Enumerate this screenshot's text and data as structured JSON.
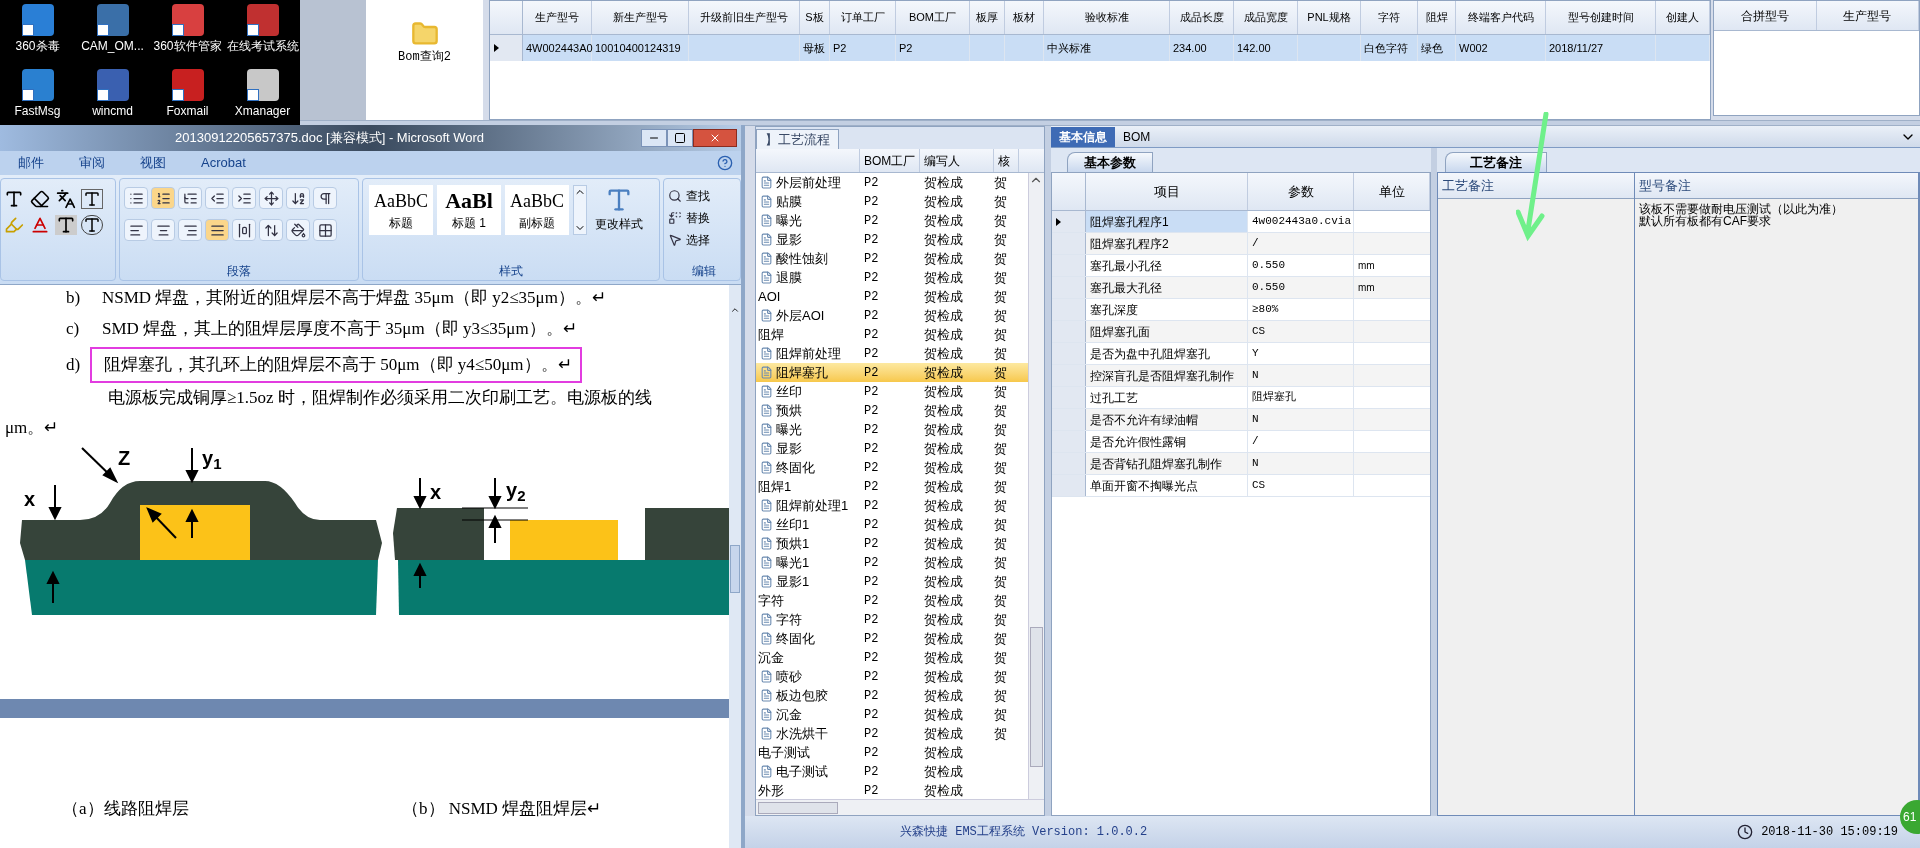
{
  "desktop": {
    "icons": [
      {
        "label": "360杀毒"
      },
      {
        "label": "CAM_OM..."
      },
      {
        "label": "360软件管家"
      },
      {
        "label": "在线考试系统"
      },
      {
        "label": "FastMsg"
      },
      {
        "label": "wincmd"
      },
      {
        "label": "Foxmail"
      },
      {
        "label": "Xmanager"
      }
    ]
  },
  "ems": {
    "nav": {
      "items": [
        {
          "label": "Bom查询2"
        }
      ]
    },
    "model_grid": {
      "columns": [
        "生产型号",
        "新生产型号",
        "升级前旧生产型号",
        "S板",
        "订单工厂",
        "BOM工厂",
        "板厚",
        "板材",
        "验收标准",
        "成品长度",
        "成品宽度",
        "PNL规格",
        "字符",
        "阻焊",
        "终端客户代码",
        "型号创建时间",
        "创建人"
      ],
      "rows": [
        {
          "selected": true,
          "cells": [
            "4W002443A0",
            "10010400124319",
            null,
            "母板",
            "P2",
            "P2",
            null,
            null,
            "中兴标准",
            "234.00",
            "142.00",
            null,
            "白色字符",
            "绿色",
            "W002",
            "2018/11/27",
            null
          ]
        }
      ]
    },
    "merge_grid": {
      "columns": [
        "合拼型号",
        "生产型号"
      ]
    },
    "process_panel": {
      "tab": "】工艺流程",
      "columns": [
        "BOM工厂",
        "编写人",
        "核"
      ],
      "rows": [
        {
          "kind": "step",
          "name": "外层前处理",
          "bom": "P2",
          "writer": "贺检成",
          "reviewer": "贺",
          "selected": false
        },
        {
          "kind": "step",
          "name": "贴膜",
          "bom": "P2",
          "writer": "贺检成",
          "reviewer": "贺",
          "selected": false
        },
        {
          "kind": "step",
          "name": "曝光",
          "bom": "P2",
          "writer": "贺检成",
          "reviewer": "贺",
          "selected": false
        },
        {
          "kind": "step",
          "name": "显影",
          "bom": "P2",
          "writer": "贺检成",
          "reviewer": "贺",
          "selected": false
        },
        {
          "kind": "step",
          "name": "酸性蚀刻",
          "bom": "P2",
          "writer": "贺检成",
          "reviewer": "贺",
          "selected": false
        },
        {
          "kind": "step",
          "name": "退膜",
          "bom": "P2",
          "writer": "贺检成",
          "reviewer": "贺",
          "selected": false
        },
        {
          "kind": "group",
          "name": "AOI",
          "bom": "P2",
          "writer": "贺检成",
          "reviewer": "贺",
          "selected": false,
          "children": [
            {
              "kind": "step",
              "name": "外层AOI",
              "bom": "P2",
              "writer": "贺检成",
              "reviewer": "贺",
              "selected": false
            }
          ]
        },
        {
          "kind": "group",
          "name": "阻焊",
          "bom": "P2",
          "writer": "贺检成",
          "reviewer": "贺",
          "selected": false,
          "children": [
            {
              "kind": "step",
              "name": "阻焊前处理",
              "bom": "P2",
              "writer": "贺检成",
              "reviewer": "贺",
              "selected": false
            },
            {
              "kind": "step",
              "name": "阻焊塞孔",
              "bom": "P2",
              "writer": "贺检成",
              "reviewer": "贺",
              "selected": true
            },
            {
              "kind": "step",
              "name": "丝印",
              "bom": "P2",
              "writer": "贺检成",
              "reviewer": "贺",
              "selected": false
            },
            {
              "kind": "step",
              "name": "预烘",
              "bom": "P2",
              "writer": "贺检成",
              "reviewer": "贺",
              "selected": false
            },
            {
              "kind": "step",
              "name": "曝光",
              "bom": "P2",
              "writer": "贺检成",
              "reviewer": "贺",
              "selected": false
            },
            {
              "kind": "step",
              "name": "显影",
              "bom": "P2",
              "writer": "贺检成",
              "reviewer": "贺",
              "selected": false
            },
            {
              "kind": "step",
              "name": "终固化",
              "bom": "P2",
              "writer": "贺检成",
              "reviewer": "贺",
              "selected": false
            }
          ]
        },
        {
          "kind": "group",
          "name": "阻焊1",
          "bom": "P2",
          "writer": "贺检成",
          "reviewer": "贺",
          "selected": false,
          "children": [
            {
              "kind": "step",
              "name": "阻焊前处理1",
              "bom": "P2",
              "writer": "贺检成",
              "reviewer": "贺",
              "selected": false
            },
            {
              "kind": "step",
              "name": "丝印1",
              "bom": "P2",
              "writer": "贺检成",
              "reviewer": "贺",
              "selected": false
            },
            {
              "kind": "step",
              "name": "预烘1",
              "bom": "P2",
              "writer": "贺检成",
              "reviewer": "贺",
              "selected": false
            },
            {
              "kind": "step",
              "name": "曝光1",
              "bom": "P2",
              "writer": "贺检成",
              "reviewer": "贺",
              "selected": false
            },
            {
              "kind": "step",
              "name": "显影1",
              "bom": "P2",
              "writer": "贺检成",
              "reviewer": "贺",
              "selected": false
            }
          ]
        },
        {
          "kind": "group",
          "name": "字符",
          "bom": "P2",
          "writer": "贺检成",
          "reviewer": "贺",
          "selected": false,
          "children": [
            {
              "kind": "step",
              "name": "字符",
              "bom": "P2",
              "writer": "贺检成",
              "reviewer": "贺",
              "selected": false
            },
            {
              "kind": "step",
              "name": "终固化",
              "bom": "P2",
              "writer": "贺检成",
              "reviewer": "贺",
              "selected": false
            }
          ]
        },
        {
          "kind": "group",
          "name": "沉金",
          "bom": "P2",
          "writer": "贺检成",
          "reviewer": "贺",
          "selected": false,
          "children": [
            {
              "kind": "step",
              "name": "喷砂",
              "bom": "P2",
              "writer": "贺检成",
              "reviewer": "贺",
              "selected": false
            },
            {
              "kind": "step",
              "name": "板边包胶",
              "bom": "P2",
              "writer": "贺检成",
              "reviewer": "贺",
              "selected": false
            },
            {
              "kind": "step",
              "name": "沉金",
              "bom": "P2",
              "writer": "贺检成",
              "reviewer": "贺",
              "selected": false
            },
            {
              "kind": "step",
              "name": "水洗烘干",
              "bom": "P2",
              "writer": "贺检成",
              "reviewer": "贺",
              "selected": false
            }
          ]
        },
        {
          "kind": "group",
          "name": "电子测试",
          "bom": "P2",
          "writer": "贺检成",
          "selected": false,
          "children": [
            {
              "kind": "step",
              "name": "电子测试",
              "bom": "P2",
              "writer": "贺检成",
              "selected": false
            }
          ]
        },
        {
          "kind": "group",
          "name": "外形",
          "bom": "P2",
          "writer": "贺检成",
          "selected": false
        }
      ]
    },
    "detail_tabs": [
      {
        "label": "基本信息",
        "selected": true
      },
      {
        "label": "BOM",
        "selected": false
      }
    ],
    "params": {
      "tab": "基本参数",
      "columns": [
        "项目",
        "参数",
        "单位"
      ],
      "rows": [
        {
          "name": "阻焊塞孔程序1",
          "value": "4w002443a0.cvia",
          "unit": null,
          "selected": true
        },
        {
          "name": "阻焊塞孔程序2",
          "value": "/",
          "unit": null,
          "selected": false
        },
        {
          "name": "塞孔最小孔径",
          "value": "0.550",
          "unit": "mm",
          "selected": false
        },
        {
          "name": "塞孔最大孔径",
          "value": "0.550",
          "unit": "mm",
          "selected": false
        },
        {
          "name": "塞孔深度",
          "value": "≥80%",
          "unit": null,
          "selected": false
        },
        {
          "name": "阻焊塞孔面",
          "value": "CS",
          "unit": null,
          "selected": false
        },
        {
          "name": "是否为盘中孔阻焊塞孔",
          "value": "Y",
          "unit": null,
          "selected": false
        },
        {
          "name": "控深盲孔是否阻焊塞孔制作",
          "value": "N",
          "unit": null,
          "selected": false
        },
        {
          "name": "过孔工艺",
          "value": "阻焊塞孔",
          "unit": null,
          "selected": false
        },
        {
          "name": "是否不允许有绿油帽",
          "value": "N",
          "unit": null,
          "selected": false
        },
        {
          "name": "是否允许假性露铜",
          "value": "/",
          "unit": null,
          "selected": false
        },
        {
          "name": "是否背钻孔阻焊塞孔制作",
          "value": "N",
          "unit": null,
          "selected": false
        },
        {
          "name": "单面开窗不掏曝光点",
          "value": "CS",
          "unit": null,
          "selected": false
        }
      ]
    },
    "notes": {
      "tab": "工艺备注",
      "columns": [
        "工艺备注",
        "型号备注"
      ],
      "model_note": [
        "该板不需要做耐电压测试（以此为准）",
        "默认所有板都有CAF要求"
      ]
    },
    "status_bar": {
      "title": "兴森快捷 EMS工程系统 Version: 1.0.0.2",
      "datetime": "2018-11-30 15:09:19"
    }
  },
  "badge": "61",
  "word": {
    "title": "20130912205657375.doc [兼容模式] - Microsoft Word",
    "ribbon_tabs": [
      {
        "label": "邮件",
        "selected": false
      },
      {
        "label": "审阅",
        "selected": false
      },
      {
        "label": "视图",
        "selected": false
      },
      {
        "label": "Acrobat",
        "selected": false
      }
    ],
    "paragraph_tools": [
      {
        "kind": "bullets",
        "active": false
      },
      {
        "kind": "numbering",
        "active": true
      },
      {
        "kind": "multilevel",
        "active": false
      },
      {
        "kind": "outdent",
        "active": false
      },
      {
        "kind": "indent",
        "active": false
      },
      {
        "kind": "layout",
        "active": false
      },
      {
        "kind": "sort",
        "active": false
      },
      {
        "kind": "marks",
        "active": false
      },
      {
        "kind": "left",
        "active": false
      },
      {
        "kind": "center",
        "active": false
      },
      {
        "kind": "right",
        "active": false
      },
      {
        "kind": "justify",
        "active": true
      },
      {
        "kind": "distribute",
        "active": false
      },
      {
        "kind": "spacing",
        "active": false
      },
      {
        "kind": "shading",
        "active": false
      },
      {
        "kind": "borders",
        "active": false
      }
    ],
    "groups": {
      "paragraph": "段落",
      "styles": "样式",
      "editing": "编辑"
    },
    "styles": [
      {
        "preview": "AaBbC",
        "name": "标题"
      },
      {
        "preview": "AaBl",
        "name": "标题 1"
      },
      {
        "preview": "AaBbC",
        "name": "副标题"
      }
    ],
    "change_styles": "更改样式",
    "editing": [
      {
        "kind": "find",
        "label": "查找"
      },
      {
        "kind": "replace",
        "label": "替换"
      },
      {
        "kind": "select",
        "label": "选择"
      }
    ],
    "document": [
      {
        "kind": "list",
        "marker": "b)",
        "text": "NSMD 焊盘，其附近的阻焊层不高于焊盘 35μm（即 y2≤35μm）。↵",
        "boxed": false
      },
      {
        "kind": "list",
        "marker": "c)",
        "text": "SMD 焊盘，其上的阻焊层厚度不高于 35μm（即 y3≤35μm）。↵",
        "boxed": false
      },
      {
        "kind": "list",
        "marker": "d)",
        "text": "阻焊塞孔，其孔环上的阻焊层不高于 50μm（即 y4≤50μm）。↵",
        "boxed": true
      },
      {
        "kind": "paragraph",
        "text": "电源板完成铜厚≥1.5oz 时，阻焊制作必须采用二次印刷工艺。电源板的线"
      },
      {
        "kind": "tail",
        "text": "μm。↵"
      }
    ],
    "diagram_labels": [
      "Z",
      "y$_{1}$",
      "x",
      "x",
      "y$_{2}$"
    ],
    "captions": [
      "（a）线路阻焊层",
      "（b） NSMD 焊盘阻焊层↵"
    ]
  }
}
